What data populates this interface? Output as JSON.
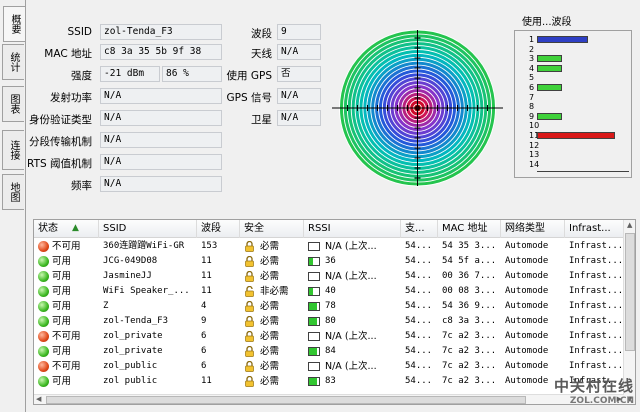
{
  "tabs": [
    "概要",
    "统计",
    "图表",
    "连接",
    "地图"
  ],
  "info": {
    "ssid_label": "SSID",
    "ssid": "zol-Tenda_F3",
    "mac_label": "MAC 地址",
    "mac": "c8 3a 35 5b 9f 38",
    "strength_label": "强度",
    "strength_dbm": "-21 dBm",
    "strength_pct": "86 %",
    "txpower_label": "发射功率",
    "txpower": "N/A",
    "auth_label": "身份验证类型",
    "auth": "N/A",
    "frag_label": "分段传输机制",
    "frag": "N/A",
    "rts_label": "RTS 阈值机制",
    "rts": "N/A",
    "freq_label": "频率",
    "freq": "N/A",
    "channel_label": "波段",
    "channel": "9",
    "antenna_label": "天线",
    "antenna": "N/A",
    "gps_use_label": "使用 GPS",
    "gps_use": "否",
    "gps_signal_label": "GPS 信号",
    "gps_signal": "N/A",
    "satellite_label": "卫星",
    "satellite": "N/A"
  },
  "channel_usage": {
    "title": "使用...波段",
    "rows": [
      {
        "num": "1",
        "level": 0.55,
        "color": "#2e3fc4"
      },
      {
        "num": "2",
        "level": 0,
        "color": ""
      },
      {
        "num": "3",
        "level": 0.27,
        "color": "#3fd13a"
      },
      {
        "num": "4",
        "level": 0.27,
        "color": "#3fd13a"
      },
      {
        "num": "5",
        "level": 0,
        "color": ""
      },
      {
        "num": "6",
        "level": 0.27,
        "color": "#3fd13a"
      },
      {
        "num": "7",
        "level": 0,
        "color": ""
      },
      {
        "num": "8",
        "level": 0,
        "color": ""
      },
      {
        "num": "9",
        "level": 0.27,
        "color": "#3fd13a"
      },
      {
        "num": "10",
        "level": 0,
        "color": ""
      },
      {
        "num": "11",
        "level": 0.85,
        "color": "#d81818"
      },
      {
        "num": "12",
        "level": 0,
        "color": ""
      },
      {
        "num": "13",
        "level": 0,
        "color": ""
      },
      {
        "num": "14",
        "level": 0,
        "color": ""
      }
    ]
  },
  "list": {
    "headers": [
      "状态",
      "SSID",
      "波段",
      "安全",
      "RSSI",
      "支...",
      "MAC 地址",
      "网络类型",
      "Infrast..."
    ],
    "rows": [
      {
        "status": "不可用",
        "ok": false,
        "ssid": "360连蹭蹭WiFi-GR",
        "channel": "153",
        "lock": true,
        "security": "必需",
        "rssi": "N/A (上次...",
        "level": 0,
        "sup": "54...",
        "mac": "54 35 3...",
        "nettype": "Automode",
        "infra": "Infrast..."
      },
      {
        "status": "可用",
        "ok": true,
        "ssid": "JCG-049D08",
        "channel": "11",
        "lock": true,
        "security": "必需",
        "rssi": "36",
        "level": 0.35,
        "sup": "54...",
        "mac": "54 5f a...",
        "nettype": "Automode",
        "infra": "Infrast..."
      },
      {
        "status": "可用",
        "ok": true,
        "ssid": "JasmineJJ",
        "channel": "11",
        "lock": true,
        "security": "必需",
        "rssi": "N/A (上次...",
        "level": 0,
        "sup": "54...",
        "mac": "00 36 7...",
        "nettype": "Automode",
        "infra": "Infrast..."
      },
      {
        "status": "可用",
        "ok": true,
        "ssid": "WiFi Speaker_...",
        "channel": "11",
        "lock": false,
        "security": "非必需",
        "rssi": "40",
        "level": 0.4,
        "sup": "54...",
        "mac": "00 08 3...",
        "nettype": "Automode",
        "infra": "Infrast..."
      },
      {
        "status": "可用",
        "ok": true,
        "ssid": "Z",
        "channel": "4",
        "lock": true,
        "security": "必需",
        "rssi": "78",
        "level": 0.78,
        "sup": "54...",
        "mac": "54 36 9...",
        "nettype": "Automode",
        "infra": "Infrast..."
      },
      {
        "status": "可用",
        "ok": true,
        "ssid": "zol-Tenda_F3",
        "channel": "9",
        "lock": true,
        "security": "必需",
        "rssi": "80",
        "level": 0.8,
        "sup": "54...",
        "mac": "c8 3a 3...",
        "nettype": "Automode",
        "infra": "Infrast..."
      },
      {
        "status": "不可用",
        "ok": false,
        "ssid": "zol_private",
        "channel": "6",
        "lock": true,
        "security": "必需",
        "rssi": "N/A (上次...",
        "level": 0,
        "sup": "54...",
        "mac": "7c a2 3...",
        "nettype": "Automode",
        "infra": "Infrast..."
      },
      {
        "status": "可用",
        "ok": true,
        "ssid": "zol_private",
        "channel": "6",
        "lock": true,
        "security": "必需",
        "rssi": "84",
        "level": 0.84,
        "sup": "54...",
        "mac": "7c a2 3...",
        "nettype": "Automode",
        "infra": "Infrast..."
      },
      {
        "status": "不可用",
        "ok": false,
        "ssid": "zol_public",
        "channel": "6",
        "lock": true,
        "security": "必需",
        "rssi": "N/A (上次...",
        "level": 0,
        "sup": "54...",
        "mac": "7c a2 3...",
        "nettype": "Automode",
        "infra": "Infrast..."
      },
      {
        "status": "可用",
        "ok": true,
        "ssid": "zol public",
        "channel": "11",
        "lock": true,
        "security": "必需",
        "rssi": "83",
        "level": 0.83,
        "sup": "54...",
        "mac": "7c a2 3...",
        "nettype": "Automode",
        "infra": "Infrast..."
      }
    ]
  },
  "watermark": {
    "line1": "中关村在线",
    "line2": "ZOL.COM.CN"
  }
}
